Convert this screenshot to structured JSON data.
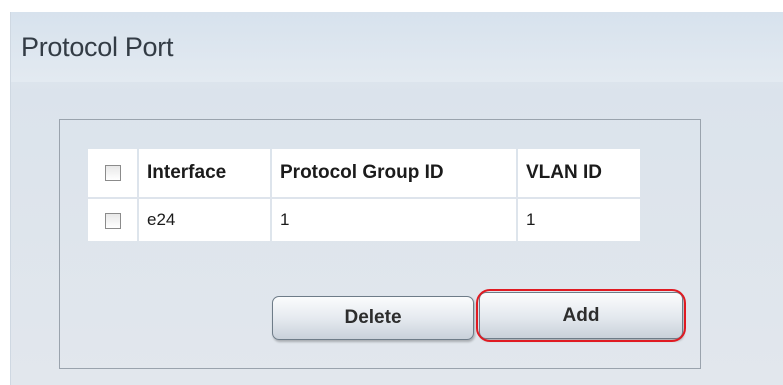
{
  "header": {
    "title": "Protocol Port"
  },
  "table": {
    "columns": [
      "Interface",
      "Protocol Group ID",
      "VLAN ID"
    ],
    "rows": [
      {
        "interface": "e24",
        "protocol_group_id": "1",
        "vlan_id": "1",
        "checked": false
      }
    ],
    "select_all_checked": false
  },
  "actions": {
    "delete_label": "Delete",
    "add_label": "Add"
  },
  "colors": {
    "highlight": "#e01a22"
  }
}
